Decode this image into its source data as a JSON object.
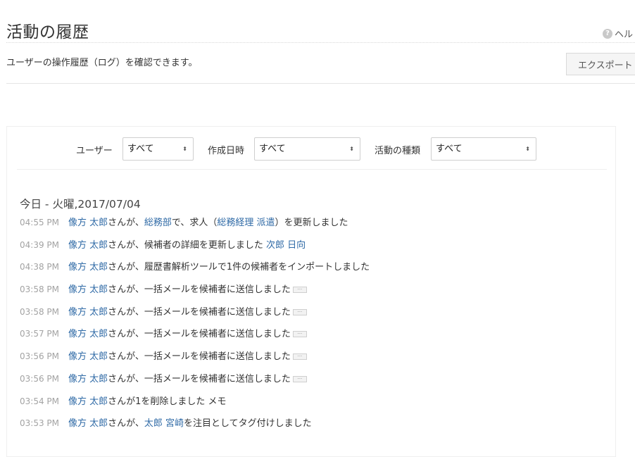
{
  "page": {
    "title": "活動の履歴",
    "help_label": "ヘル",
    "help_icon": "question-icon",
    "subtitle": "ユーザーの操作履歴（ログ）を確認できます。",
    "export_label": "エクスポート"
  },
  "filters": {
    "user_label": "ユーザー",
    "user_value": "すべて",
    "created_label": "作成日時",
    "created_value": "すべて",
    "type_label": "活動の種類",
    "type_value": "すべて"
  },
  "day_heading": "今日 - 火曜,2017/07/04",
  "link_color": "#2f6aa6",
  "entries": [
    {
      "time": "04:55 PM",
      "user": "像方 太郎",
      "t1": "さんが、",
      "link1": "総務部",
      "t2": "で、求人（",
      "link2": "総務経理 派遣",
      "t3": "）を更新しました"
    },
    {
      "time": "04:39 PM",
      "user": "像方 太郎",
      "t1": "さんが、候補者の詳細を更新しました ",
      "link1": "次郎 日向"
    },
    {
      "time": "04:38 PM",
      "user": "像方 太郎",
      "t1": "さんが、履歴書解析ツールで1件の候補者をインポートしました"
    },
    {
      "time": "03:58 PM",
      "user": "像方 太郎",
      "t1": "さんが、一括メールを候補者に送信しました",
      "more": "···"
    },
    {
      "time": "03:58 PM",
      "user": "像方 太郎",
      "t1": "さんが、一括メールを候補者に送信しました",
      "more": "···"
    },
    {
      "time": "03:57 PM",
      "user": "像方 太郎",
      "t1": "さんが、一括メールを候補者に送信しました",
      "more": "···"
    },
    {
      "time": "03:56 PM",
      "user": "像方 太郎",
      "t1": "さんが、一括メールを候補者に送信しました",
      "more": "···"
    },
    {
      "time": "03:56 PM",
      "user": "像方 太郎",
      "t1": "さんが、一括メールを候補者に送信しました",
      "more": "···"
    },
    {
      "time": "03:54 PM",
      "user": "像方 太郎",
      "t1": "さんが1を削除しました メモ"
    },
    {
      "time": "03:53 PM",
      "user": "像方 太郎",
      "t1": "さんが、",
      "link1": "太郎 宮崎",
      "t2": "を注目としてタグ付けしました"
    }
  ]
}
